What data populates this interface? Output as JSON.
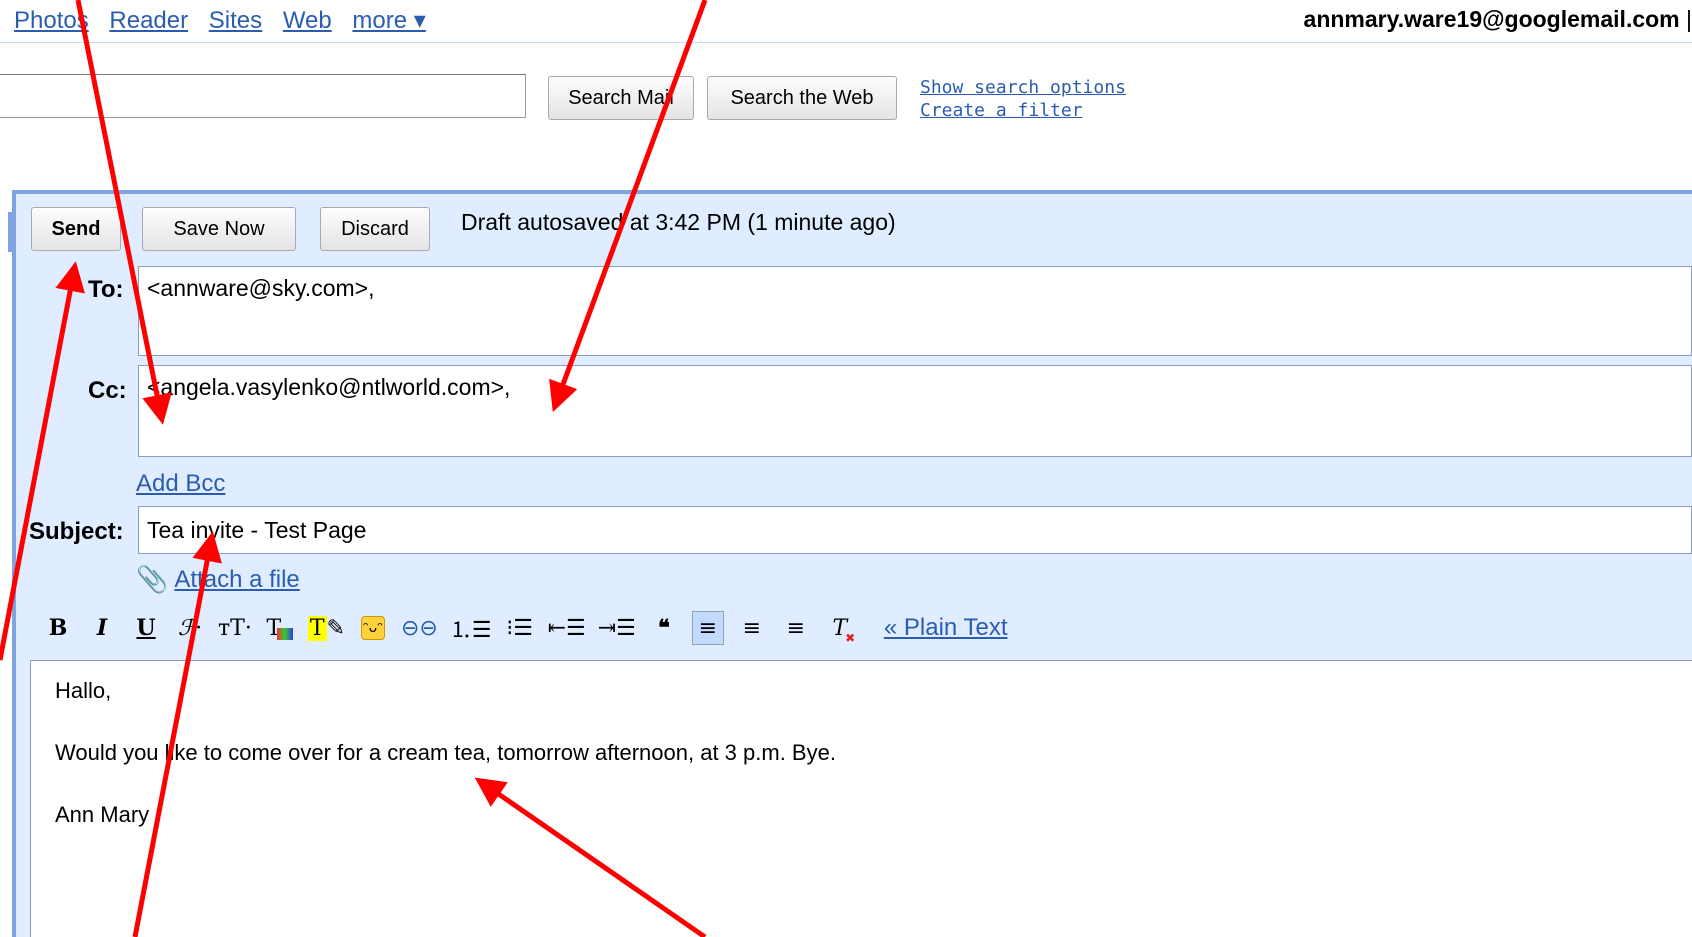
{
  "nav": {
    "items": [
      "Photos",
      "Reader",
      "Sites",
      "Web",
      "more ▾"
    ]
  },
  "account": {
    "email": "annmary.ware19@googlemail.com",
    "separator": "|"
  },
  "search": {
    "input_value": "",
    "mail_button": "Search Mail",
    "web_button": "Search the Web",
    "options_link": "Show search options",
    "filter_link": "Create a filter"
  },
  "compose": {
    "send": "Send",
    "save_now": "Save Now",
    "discard": "Discard",
    "autosave": "Draft autosaved at 3:42 PM (1 minute ago)",
    "to_label": "To:",
    "to_value": "<annware@sky.com>,",
    "cc_label": "Cc:",
    "cc_value": "<angela.vasylenko@ntlworld.com>,",
    "add_bcc": "Add Bcc",
    "subject_label": "Subject:",
    "subject_value": "Tea invite - Test Page",
    "attach": "Attach a file",
    "plain_text": "« Plain Text",
    "body": [
      "Hallo,",
      "Would you like to come over for a cream tea, tomorrow afternoon, at 3 p.m.  Bye.",
      "Ann Mary"
    ]
  },
  "toolbar": {
    "icons": [
      "bold-icon",
      "italic-icon",
      "underline-icon",
      "font-icon",
      "font-size-icon",
      "text-color-icon",
      "highlight-color-icon",
      "emoticon-icon",
      "link-icon",
      "numbered-list-icon",
      "bulleted-list-icon",
      "indent-less-icon",
      "indent-more-icon",
      "quote-icon",
      "align-left-icon",
      "align-center-icon",
      "align-right-icon",
      "remove-formatting-icon"
    ]
  },
  "colors": {
    "link": "#2a5db0",
    "compose_bg": "#e0ecff",
    "compose_border": "#7fa4e0",
    "annotation_arrow": "#ff0000"
  }
}
